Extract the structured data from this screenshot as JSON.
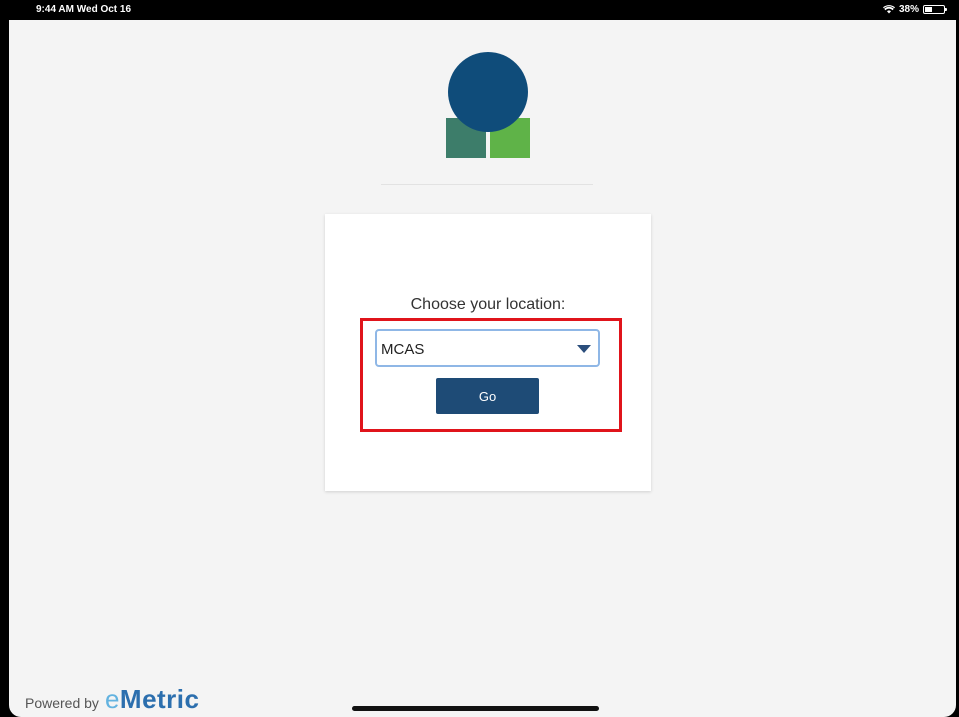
{
  "status_bar": {
    "time_date": "9:44 AM  Wed Oct 16",
    "battery": "38%",
    "battery_level": 0.38
  },
  "logo": {
    "icon": "organization-logo-icon",
    "colors": {
      "circle": "#0f4c7a",
      "left_block": "#3d7d6a",
      "right_block": "#5fb348"
    }
  },
  "card": {
    "prompt": "Choose your location:",
    "location_select": {
      "selected": "MCAS",
      "icon": "caret-down-icon"
    },
    "go_label": "Go"
  },
  "highlight_color": "#e0141b",
  "footer": {
    "powered_by": "Powered by",
    "brand_prefix": "e",
    "brand_suffix": "Metric"
  }
}
